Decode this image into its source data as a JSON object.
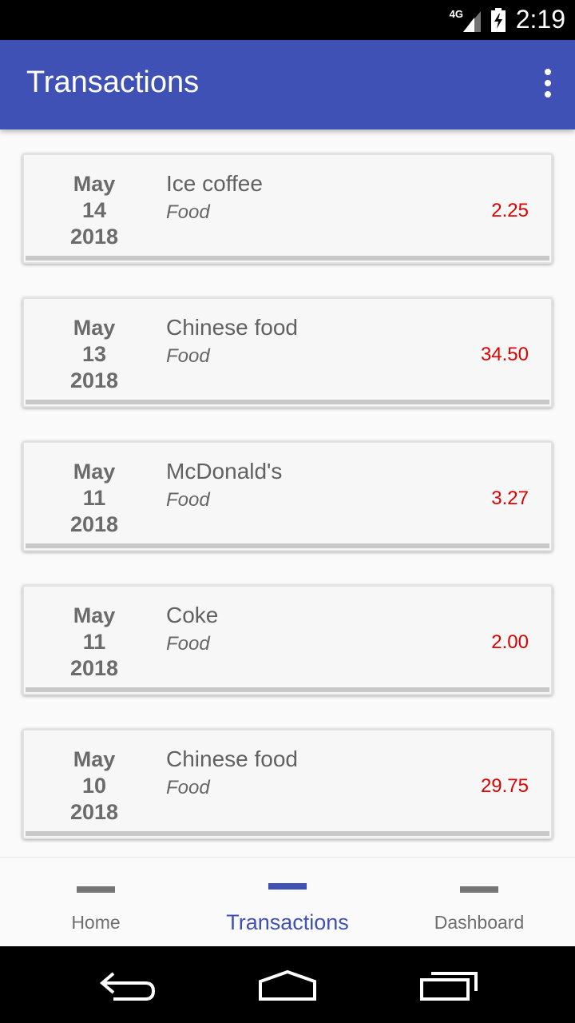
{
  "status_bar": {
    "network": "4G",
    "time": "2:19",
    "icons": [
      "signal-icon",
      "battery-charging-icon"
    ]
  },
  "app_bar": {
    "title": "Transactions",
    "menu_icon": "more-vert-icon"
  },
  "transactions": [
    {
      "month": "May",
      "day": "14",
      "year": "2018",
      "name": "Ice coffee",
      "category": "Food",
      "amount": "2.25"
    },
    {
      "month": "May",
      "day": "13",
      "year": "2018",
      "name": "Chinese food",
      "category": "Food",
      "amount": "34.50"
    },
    {
      "month": "May",
      "day": "11",
      "year": "2018",
      "name": "McDonald's",
      "category": "Food",
      "amount": "3.27"
    },
    {
      "month": "May",
      "day": "11",
      "year": "2018",
      "name": "Coke",
      "category": "Food",
      "amount": "2.00"
    },
    {
      "month": "May",
      "day": "10",
      "year": "2018",
      "name": "Chinese food",
      "category": "Food",
      "amount": "29.75"
    }
  ],
  "bottom_nav": {
    "items": [
      {
        "label": "Home",
        "active": false
      },
      {
        "label": "Transactions",
        "active": true
      },
      {
        "label": "Dashboard",
        "active": false
      }
    ]
  },
  "system_nav": {
    "icons": [
      "back-icon",
      "home-icon",
      "recents-icon"
    ]
  },
  "colors": {
    "primary": "#3f51b5",
    "amount": "#e00000",
    "text_secondary": "#616161"
  }
}
